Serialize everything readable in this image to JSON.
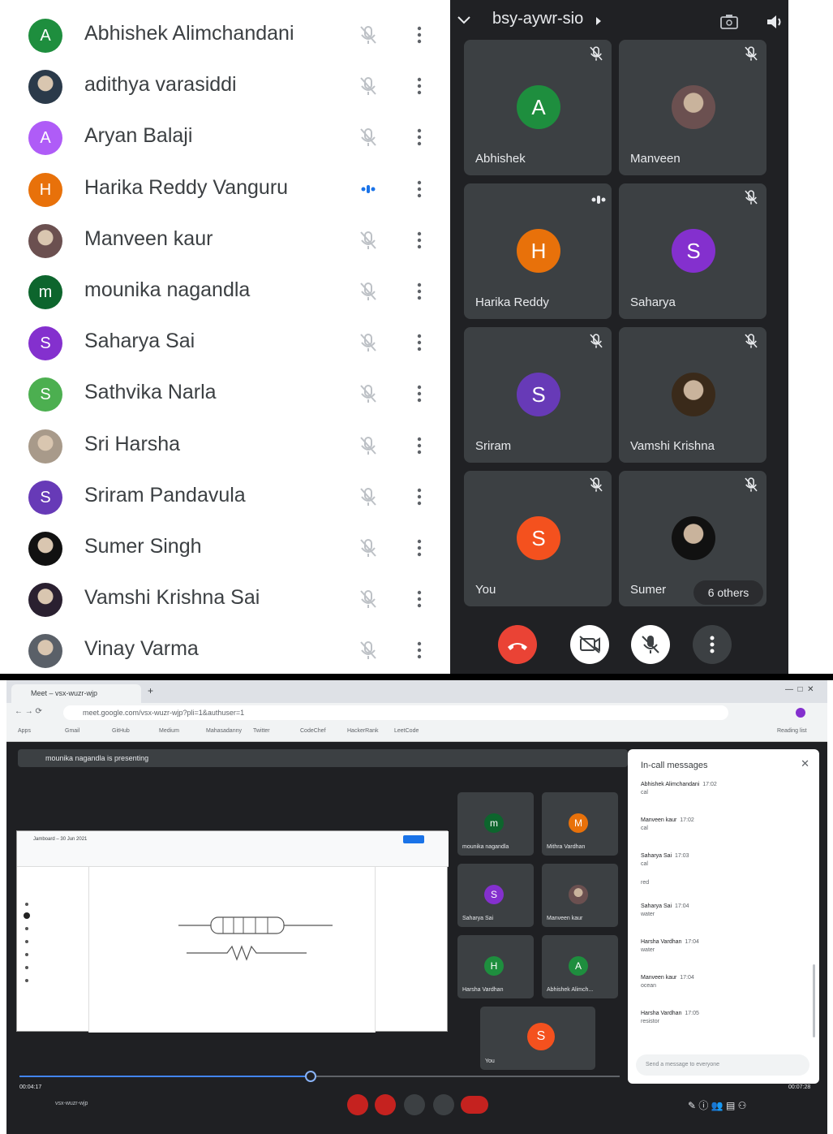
{
  "participants": [
    {
      "name": "Abhishek Alimchandani",
      "initial": "A",
      "color": "#1e8e3e",
      "type": "letter",
      "mic": "muted"
    },
    {
      "name": "adithya varasiddi",
      "initial": "",
      "color": "#2b3a4a",
      "type": "photo",
      "mic": "muted"
    },
    {
      "name": "Aryan Balaji",
      "initial": "A",
      "color": "#af5cf7",
      "type": "letter",
      "mic": "muted"
    },
    {
      "name": "Harika Reddy Vanguru",
      "initial": "H",
      "color": "#e8710a",
      "type": "letter",
      "mic": "speaking"
    },
    {
      "name": "Manveen kaur",
      "initial": "",
      "color": "#6b5050",
      "type": "photo",
      "mic": "muted"
    },
    {
      "name": "mounika nagandla",
      "initial": "m",
      "color": "#0d652d",
      "type": "letter",
      "mic": "muted"
    },
    {
      "name": "Saharya Sai",
      "initial": "S",
      "color": "#8430ce",
      "type": "letter",
      "mic": "muted"
    },
    {
      "name": "Sathvika Narla",
      "initial": "S",
      "color": "#4caf50",
      "type": "letter",
      "mic": "muted"
    },
    {
      "name": "Sri Harsha",
      "initial": "",
      "color": "#a89a8a",
      "type": "photo",
      "mic": "muted"
    },
    {
      "name": "Sriram Pandavula",
      "initial": "S",
      "color": "#673ab7",
      "type": "letter",
      "mic": "muted"
    },
    {
      "name": "Sumer Singh",
      "initial": "",
      "color": "#111111",
      "type": "photo",
      "mic": "muted"
    },
    {
      "name": "Vamshi Krishna Sai",
      "initial": "",
      "color": "#2a2030",
      "type": "photo",
      "mic": "muted"
    },
    {
      "name": "Vinay Varma",
      "initial": "",
      "color": "#5a6068",
      "type": "photo",
      "mic": "muted"
    }
  ],
  "meeting": {
    "code": "bsy-aywr-sio",
    "tiles": [
      {
        "name": "Abhishek",
        "initial": "A",
        "color": "#1e8e3e",
        "type": "letter",
        "mic": "muted"
      },
      {
        "name": "Manveen",
        "initial": "",
        "color": "#6b5050",
        "type": "photo",
        "mic": "muted"
      },
      {
        "name": "Harika Reddy",
        "initial": "H",
        "color": "#e8710a",
        "type": "letter",
        "mic": "speaking"
      },
      {
        "name": "Saharya",
        "initial": "S",
        "color": "#8430ce",
        "type": "letter",
        "mic": "muted"
      },
      {
        "name": "Sriram",
        "initial": "S",
        "color": "#673ab7",
        "type": "letter",
        "mic": "muted"
      },
      {
        "name": "Vamshi Krishna",
        "initial": "",
        "color": "#3a2a1a",
        "type": "photo",
        "mic": "muted"
      },
      {
        "name": "You",
        "initial": "S",
        "color": "#f4511e",
        "type": "letter",
        "mic": "muted"
      },
      {
        "name": "Sumer",
        "initial": "",
        "color": "#111111",
        "type": "photo",
        "mic": "muted"
      }
    ],
    "others_label": "6 others"
  },
  "browser": {
    "tab_title": "Meet – vsx-wuzr-wjp",
    "url": "meet.google.com/vsx-wuzr-wjp?pli=1&authuser=1",
    "bookmarks": [
      "Apps",
      "Gmail",
      "GitHub",
      "Medium",
      "Mahasadanny",
      "Twitter",
      "CodeChef",
      "HackerRank",
      "LeetCode",
      "Reading list"
    ],
    "presenting": "mounika nagandla is presenting",
    "slide_title": "Jamboard – 30 Jun 2021",
    "tiles": [
      {
        "name": "mounika nagandla",
        "initial": "m",
        "color": "#0d652d"
      },
      {
        "name": "Mithra Vardhan",
        "initial": "M",
        "color": "#e8710a"
      },
      {
        "name": "Saharya Sai",
        "initial": "S",
        "color": "#8430ce"
      },
      {
        "name": "Manveen kaur",
        "initial": "",
        "color": "#6b5050"
      },
      {
        "name": "Harsha Vardhan",
        "initial": "H",
        "color": "#1e8e3e"
      },
      {
        "name": "Abhishek Alimch...",
        "initial": "A",
        "color": "#1e8e3e"
      },
      {
        "name": "You",
        "initial": "S",
        "color": "#f4511e"
      }
    ],
    "chat": {
      "title": "In-call messages",
      "messages": [
        {
          "sender": "Abhishek Alimchandani",
          "time": "17:02",
          "text": "cal"
        },
        {
          "sender": "Manveen kaur",
          "time": "17:02",
          "text": "cal"
        },
        {
          "sender": "Saharya Sai",
          "time": "17:03",
          "text": "cal"
        },
        {
          "sender": "",
          "time": "",
          "text": "red"
        },
        {
          "sender": "Saharya Sai",
          "time": "17:04",
          "text": "water"
        },
        {
          "sender": "Harsha Vardhan",
          "time": "17:04",
          "text": "water"
        },
        {
          "sender": "Manveen kaur",
          "time": "17:04",
          "text": "ocean"
        },
        {
          "sender": "Harsha Vardhan",
          "time": "17:05",
          "text": "resistor"
        }
      ],
      "input_placeholder": "Send a message to everyone"
    },
    "time_left": "00:04:17",
    "time_right": "00:07:28",
    "meeting_code": "vsx-wuzr-wjp"
  }
}
